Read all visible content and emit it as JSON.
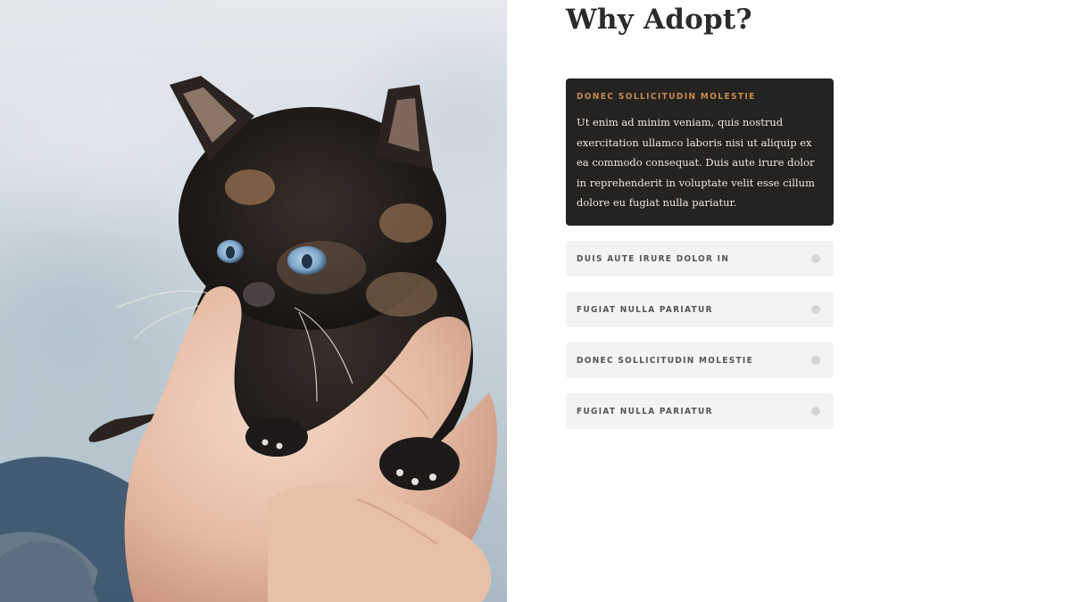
{
  "hero": {
    "image_name": "kitten-in-hands-photo"
  },
  "section": {
    "title": "Why Adopt?"
  },
  "accordion": {
    "open_item": {
      "heading": "DONEC SOLLICITUDIN MOLESTIE",
      "body": "Ut enim ad minim veniam, quis nostrud exercitation ullamco laboris nisi ut aliquip ex ea commodo consequat. Duis aute irure dolor in reprehenderit in voluptate velit esse cillum dolore eu fugiat nulla pariatur."
    },
    "items": [
      {
        "label": "DUIS AUTE IRURE DOLOR IN"
      },
      {
        "label": "FUGIAT NULLA PARIATUR"
      },
      {
        "label": "DONEC SOLLICITUDIN MOLESTIE"
      },
      {
        "label": "FUGIAT NULLA PARIATUR"
      }
    ],
    "toggle_icon": "circle-toggle-icon"
  },
  "colors": {
    "open_bg": "#252321",
    "accent": "#c98a4c",
    "item_bg": "#f3f3f3",
    "title": "#2b2b2b"
  }
}
